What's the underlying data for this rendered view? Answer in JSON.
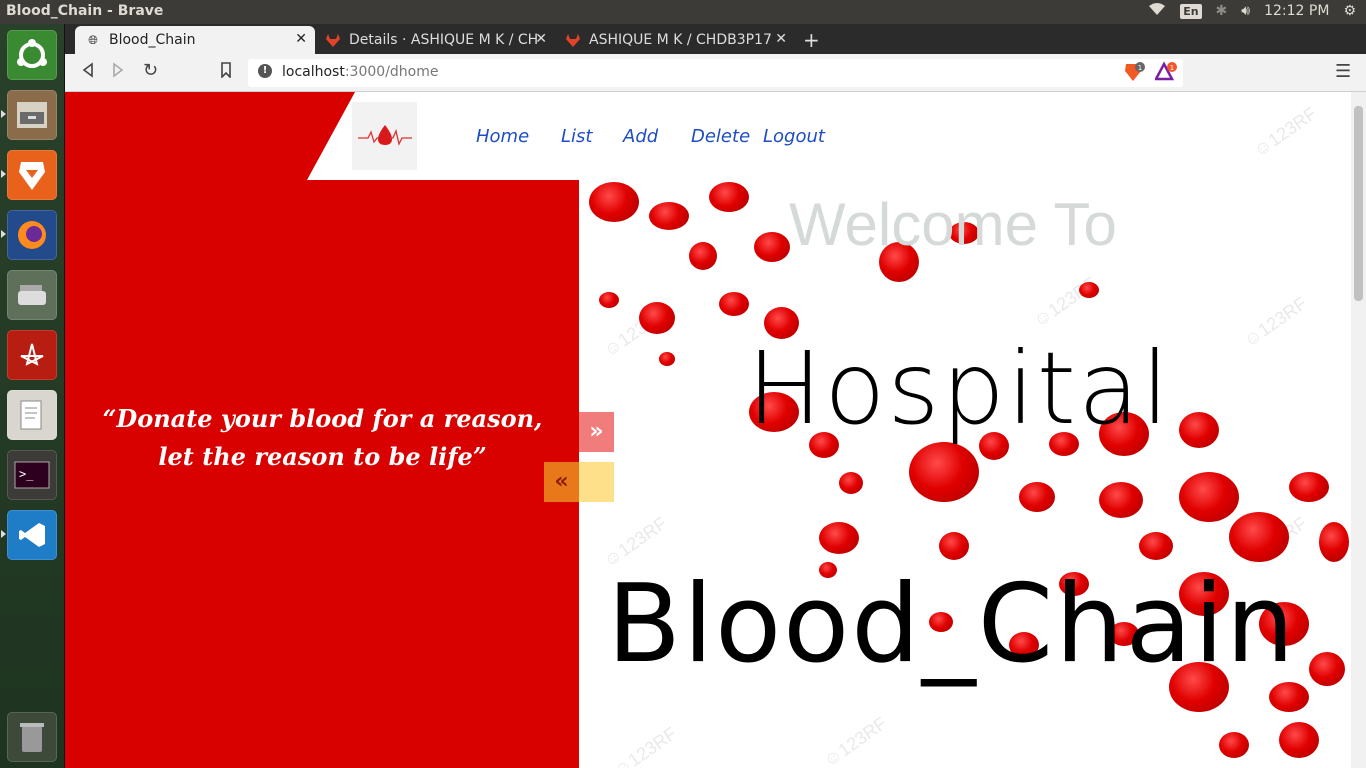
{
  "window": {
    "title": "Blood_Chain - Brave"
  },
  "tray": {
    "keyboard": "En",
    "clock": "12:12 PM"
  },
  "tabs": [
    {
      "label": "Blood_Chain",
      "icon": "globe-icon"
    },
    {
      "label": "Details · ASHIQUE M K / CH",
      "icon": "gitlab-icon"
    },
    {
      "label": "ASHIQUE M K / CHDB3P17",
      "icon": "gitlab-icon"
    }
  ],
  "address": {
    "host": "localhost",
    "path": ":3000/dhome"
  },
  "extensions": {
    "brave_shields_count": "1",
    "rewards_count": "1"
  },
  "nav": {
    "items": [
      "Home",
      "List",
      "Add",
      "Delete",
      "Logout"
    ]
  },
  "hero": {
    "quote": "“Donate your blood for a reason, let the reason to be life”",
    "welcome": "Welcome To",
    "hospital": "Hospital",
    "brand": "Blood_Chain"
  },
  "carousel": {
    "next_symbol": "»",
    "prev_symbol": "«"
  },
  "colors": {
    "primary_red": "#d90000",
    "nav_link": "#1e4ec2",
    "next_bg": "#f07c7c",
    "prev_bg": "#e8781a"
  }
}
